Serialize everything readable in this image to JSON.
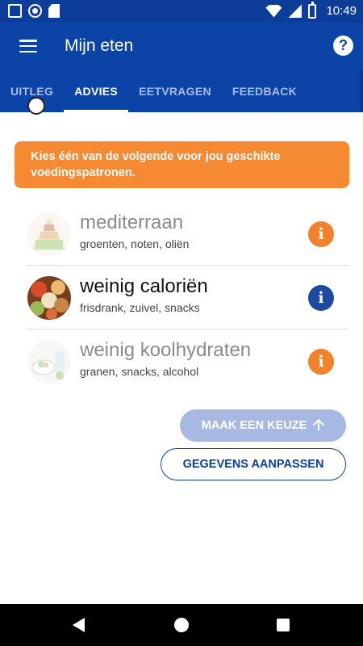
{
  "status_bar": {
    "time": "10:49"
  },
  "app_bar": {
    "title": "Mijn eten",
    "help_label": "?"
  },
  "tabs": [
    {
      "label": "UITLEG",
      "active": false
    },
    {
      "label": "ADVIES",
      "active": true
    },
    {
      "label": "EETVRAGEN",
      "active": false
    },
    {
      "label": "FEEDBACK",
      "active": false
    }
  ],
  "banner": {
    "text": "Kies één van de volgende voor jou geschikte voedingspatronen."
  },
  "options": [
    {
      "title": "mediterraan",
      "subtitle": "groenten, noten, oliën",
      "selected": false,
      "info_color": "#f0822d",
      "icon": "food-pyramid"
    },
    {
      "title": "weinig caloriën",
      "subtitle": "frisdrank, zuivel, snacks",
      "selected": true,
      "info_color": "#1c4aa1",
      "icon": "mixed-foods"
    },
    {
      "title": "weinig koolhydraten",
      "subtitle": "granen, snacks, alcohol",
      "selected": false,
      "info_color": "#f0822d",
      "icon": "low-carb-foods"
    }
  ],
  "info_label": "i",
  "buttons": {
    "choice_label": "MAAK EEN KEUZE",
    "edit_label": "GEGEVENS AANPASSEN"
  },
  "colors": {
    "primary": "#0b43a6",
    "accent": "#f58a33",
    "disabled": "#a7b9e2"
  }
}
